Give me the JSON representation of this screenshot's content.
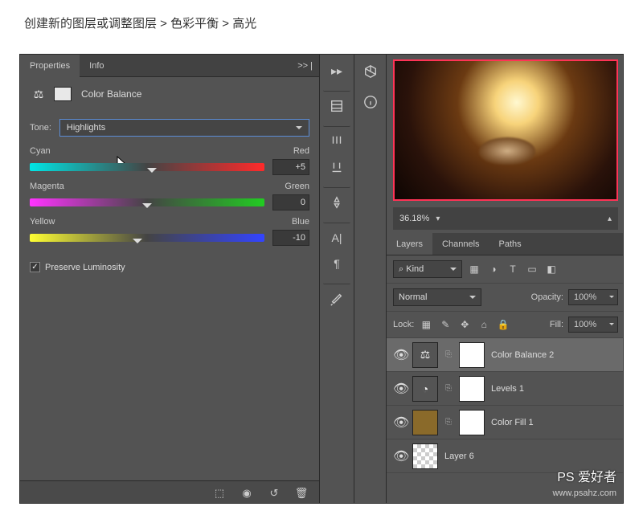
{
  "caption": "创建新的图层或调整图层 > 色彩平衡 > 高光",
  "tabs": {
    "properties": "Properties",
    "info": "Info",
    "more": ">> |"
  },
  "colorBalance": {
    "title": "Color Balance",
    "toneLabel": "Tone:",
    "toneValue": "Highlights",
    "sliders": [
      {
        "left": "Cyan",
        "right": "Red",
        "value": "+5"
      },
      {
        "left": "Magenta",
        "right": "Green",
        "value": "0"
      },
      {
        "left": "Yellow",
        "right": "Blue",
        "value": "-10"
      }
    ],
    "preserve": "Preserve Luminosity",
    "check": "✓"
  },
  "footerIcons": {
    "clip": "⬚",
    "eye": "◉",
    "reset": "↺",
    "trash": "🗑"
  },
  "zoom": {
    "value": "36.18%",
    "down": "▾",
    "up": "▴"
  },
  "layersPanel": {
    "tabs": {
      "layers": "Layers",
      "channels": "Channels",
      "paths": "Paths"
    },
    "kindLabel": "Kind",
    "search": "⌕",
    "blend": "Normal",
    "opacityLabel": "Opacity:",
    "opacityValue": "100%",
    "lockLabel": "Lock:",
    "fillLabel": "Fill:",
    "fillValue": "100%",
    "filterIcons": {
      "img": "▦",
      "adj": "◑",
      "type": "T",
      "shape": "▭",
      "smart": "�االل"
    },
    "lockIcons": {
      "px": "▦",
      "brush": "✎",
      "move": "✥",
      "art": "⌂",
      "all": "🔒"
    },
    "layers": [
      {
        "name": "Color Balance 2",
        "type": "adj-scales"
      },
      {
        "name": "Levels 1",
        "type": "adj-generic"
      },
      {
        "name": "Color Fill 1",
        "type": "fill"
      },
      {
        "name": "Layer 6",
        "type": "pixel"
      }
    ]
  },
  "watermark": {
    "logo": "PS 爱好者",
    "url": "www.psahz.com"
  }
}
